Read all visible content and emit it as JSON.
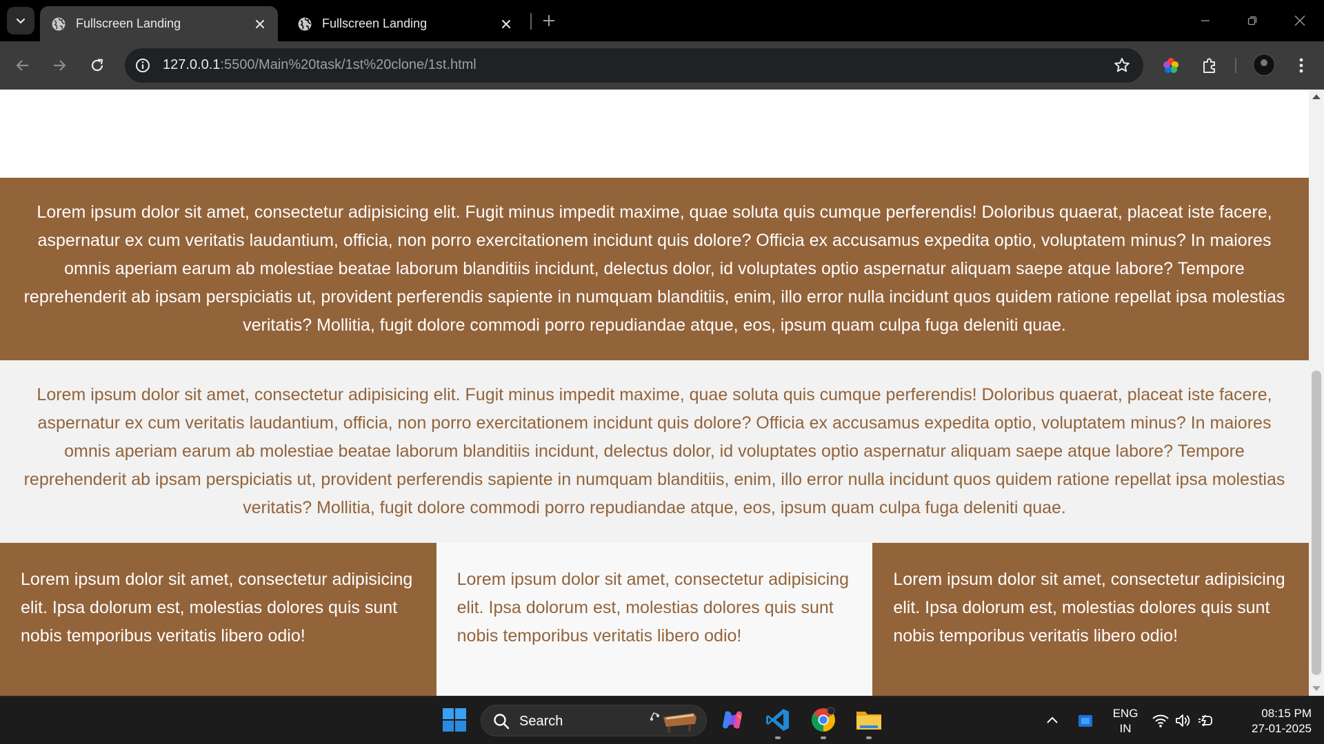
{
  "browser": {
    "tabs": [
      {
        "title": "Fullscreen Landing",
        "active": true
      },
      {
        "title": "Fullscreen Landing",
        "active": false
      }
    ],
    "url": {
      "host": "127.0.0.1",
      "rest": ":5500/Main%20task/1st%20clone/1st.html"
    }
  },
  "page": {
    "band_text": "Lorem ipsum dolor sit amet, consectetur adipisicing elit. Fugit minus impedit maxime, quae soluta quis cumque perferendis! Doloribus quaerat, placeat iste facere, aspernatur ex cum veritatis laudantium, officia, non porro exercitationem incidunt quis dolore? Officia ex accusamus expedita optio, voluptatem minus? In maiores omnis aperiam earum ab molestiae beatae laborum blanditiis incidunt, delectus dolor, id voluptates optio aspernatur aliquam saepe atque labore? Tempore reprehenderit ab ipsam perspiciatis ut, provident perferendis sapiente in numquam blanditiis, enim, illo error nulla incidunt quos quidem ratione repellat ipsa molestias veritatis? Mollitia, fugit dolore commodi porro repudiandae atque, eos, ipsum quam culpa fuga deleniti quae.",
    "columns": [
      "Lorem ipsum dolor sit amet, consectetur adipisicing elit. Ipsa dolorum est, molestias dolores quis sunt nobis temporibus veritatis libero odio!",
      "Lorem ipsum dolor sit amet, consectetur adipisicing elit. Ipsa dolorum est, molestias dolores quis sunt nobis temporibus veritatis libero odio!",
      "Lorem ipsum dolor sit amet, consectetur adipisicing elit. Ipsa dolorum est, molestias dolores quis sunt nobis temporibus veritatis libero odio!"
    ],
    "colors": {
      "brown": "#93633a",
      "light": "#f2f2f2",
      "white": "#ffffff"
    }
  },
  "taskbar": {
    "search_label": "Search",
    "lang": [
      "ENG",
      "IN"
    ],
    "time": "08:15 PM",
    "date": "27-01-2025",
    "icons": [
      "windows-start-icon",
      "copilot-icon",
      "vscode-icon",
      "chrome-icon",
      "file-explorer-icon"
    ]
  }
}
